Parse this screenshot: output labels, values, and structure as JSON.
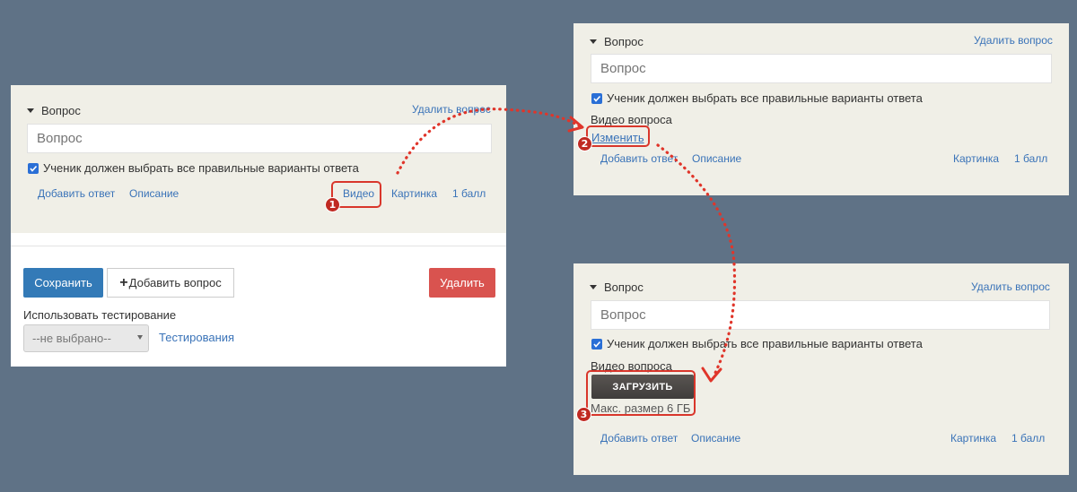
{
  "panel1": {
    "question_header": "Вопрос",
    "delete_question": "Удалить вопрос",
    "question_placeholder": "Вопрос",
    "checkbox_label": "Ученик должен выбрать все правильные варианты ответа",
    "links": {
      "add_answer": "Добавить ответ",
      "description": "Описание",
      "video": "Видео",
      "picture": "Картинка",
      "points": "1 балл"
    },
    "badge": "1",
    "save_button": "Сохранить",
    "add_question_button": "Добавить вопрос",
    "add_question_plus": "+",
    "delete_button": "Удалить",
    "use_testing_label": "Использовать тестирование",
    "select_value": "--не выбрано--",
    "testing_link": "Тестирования"
  },
  "panel2": {
    "question_header": "Вопрос",
    "delete_question": "Удалить вопрос",
    "question_placeholder": "Вопрос",
    "checkbox_label": "Ученик должен выбрать все правильные варианты ответа",
    "video_label": "Видео вопроса",
    "change_link": "Изменить",
    "badge": "2",
    "links": {
      "add_answer": "Добавить ответ",
      "description": "Описание",
      "picture": "Картинка",
      "points": "1 балл"
    }
  },
  "panel3": {
    "question_header": "Вопрос",
    "delete_question": "Удалить вопрос",
    "question_placeholder": "Вопрос",
    "checkbox_label": "Ученик должен выбрать все правильные варианты ответа",
    "video_label": "Видео вопроса",
    "upload_button": "ЗАГРУЗИТЬ",
    "max_size": "Макс. размер 6 ГБ",
    "badge": "3",
    "links": {
      "add_answer": "Добавить ответ",
      "description": "Описание",
      "picture": "Картинка",
      "points": "1 балл"
    }
  },
  "colors": {
    "background": "#5f7286",
    "panel": "#f0efe7",
    "link": "#3a73b8",
    "save": "#337ab7",
    "delete": "#d9534f",
    "highlight": "#d9362b",
    "upload": "#4a4745"
  }
}
